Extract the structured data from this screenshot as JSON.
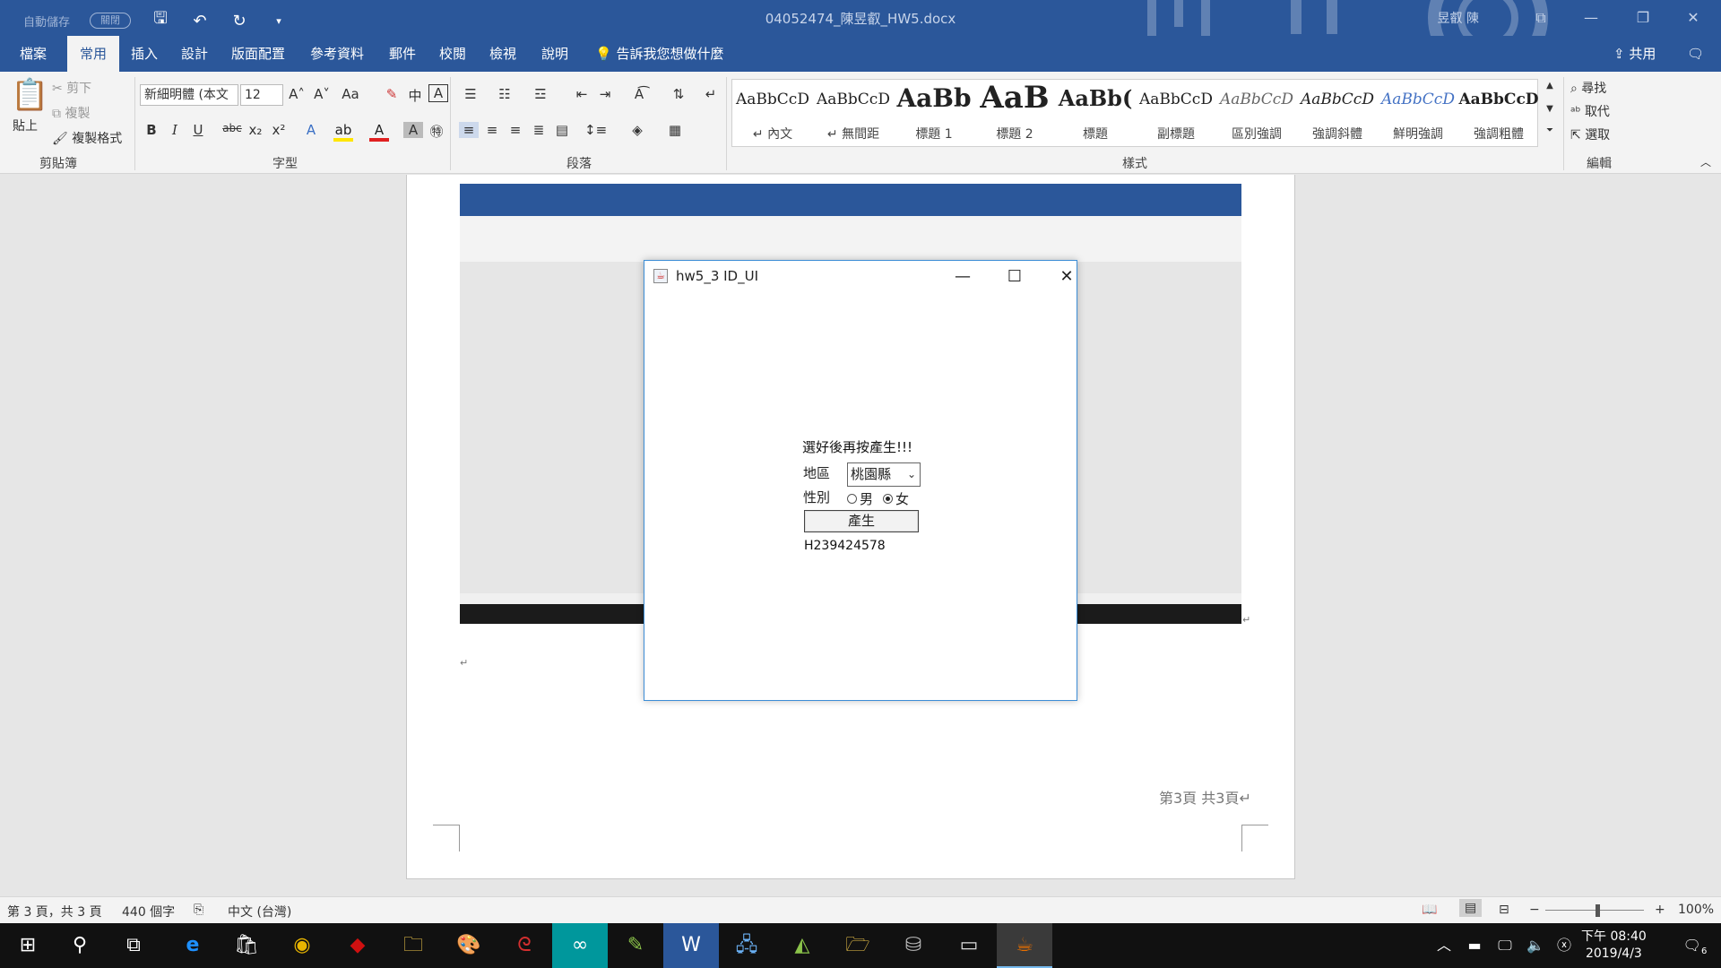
{
  "titlebar": {
    "autosave": "自動儲存",
    "autosave_state": "關閉",
    "doc_title": "04052474_陳昱叡_HW5.docx",
    "user": "昱叡 陳"
  },
  "tabs": [
    "檔案",
    "常用",
    "插入",
    "設計",
    "版面配置",
    "參考資料",
    "郵件",
    "校閱",
    "檢視",
    "說明"
  ],
  "tell_me": "告訴我您想做什麼",
  "share": "共用",
  "ribbon": {
    "clipboard": {
      "paste": "貼上",
      "cut": "剪下",
      "copy": "複製",
      "format_painter": "複製格式",
      "label": "剪貼簿"
    },
    "font": {
      "name": "新細明體 (本文",
      "size": "12",
      "label": "字型"
    },
    "paragraph": {
      "label": "段落"
    },
    "styles": {
      "label": "樣式",
      "items": [
        {
          "sample": "AaBbCcD",
          "name": "↵ 內文"
        },
        {
          "sample": "AaBbCcD",
          "name": "↵ 無間距"
        },
        {
          "sample": "AaBb",
          "name": "標題 1"
        },
        {
          "sample": "AaB",
          "name": "標題 2"
        },
        {
          "sample": "AaBb(",
          "name": "標題"
        },
        {
          "sample": "AaBbCcD",
          "name": "副標題"
        },
        {
          "sample": "AaBbCcD",
          "name": "區別強調"
        },
        {
          "sample": "AaBbCcD",
          "name": "強調斜體"
        },
        {
          "sample": "AaBbCcD",
          "name": "鮮明強調"
        },
        {
          "sample": "AaBbCcD",
          "name": "強調粗體"
        }
      ]
    },
    "editing": {
      "find": "尋找",
      "replace": "取代",
      "select": "選取",
      "label": "編輯"
    }
  },
  "page": {
    "footer": "第3頁  共3頁↵"
  },
  "dialog": {
    "title": "hw5_3 ID_UI",
    "hint": "選好後再按產生!!!",
    "region_label": "地區",
    "region_value": "桃園縣",
    "gender_label": "性別",
    "gender_male": "男",
    "gender_female": "女",
    "gender_selected": "女",
    "generate_button": "產生",
    "output_id": "H239424578"
  },
  "statusbar": {
    "page": "第 3 頁，共 3 頁",
    "words": "440 個字",
    "language": "中文 (台灣)",
    "zoom": "100%"
  },
  "taskbar": {
    "time": "下午 08:40",
    "date": "2019/4/3",
    "notifications": "6"
  }
}
